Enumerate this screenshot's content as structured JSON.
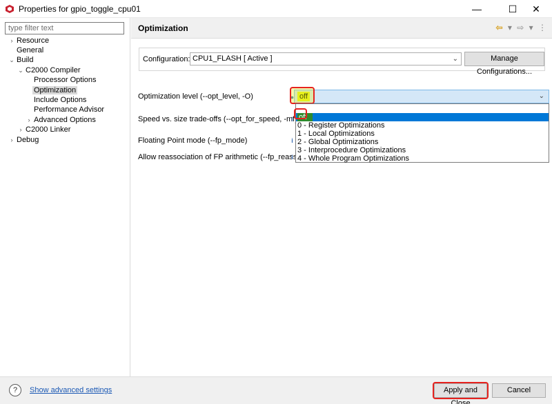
{
  "window": {
    "title": "Properties for gpio_toggle_cpu01",
    "min_icon": "minimize-icon",
    "max_icon": "maximize-icon",
    "close_icon": "close-icon"
  },
  "sidebar": {
    "filter_placeholder": "type filter text",
    "items": [
      {
        "label": "Resource",
        "twisty": "›",
        "level": 0
      },
      {
        "label": "General",
        "twisty": "",
        "level": 0
      },
      {
        "label": "Build",
        "twisty": "⌄",
        "level": 0
      },
      {
        "label": "C2000 Compiler",
        "twisty": "⌄",
        "level": 1
      },
      {
        "label": "Processor Options",
        "twisty": "",
        "level": 2
      },
      {
        "label": "Optimization",
        "twisty": "",
        "level": 2,
        "selected": true
      },
      {
        "label": "Include Options",
        "twisty": "",
        "level": 2
      },
      {
        "label": "Performance Advisor",
        "twisty": "",
        "level": 2
      },
      {
        "label": "Advanced Options",
        "twisty": "›",
        "level": 2
      },
      {
        "label": "C2000 Linker",
        "twisty": "›",
        "level": 1
      },
      {
        "label": "Debug",
        "twisty": "›",
        "level": 0
      }
    ]
  },
  "main": {
    "title": "Optimization",
    "configuration": {
      "label": "Configuration:",
      "value": "CPU1_FLASH  [ Active ]",
      "manage_button": "Manage Configurations..."
    },
    "options": [
      {
        "label": "Optimization level (--opt_level, -O)"
      },
      {
        "label": "Speed vs. size trade-offs (--opt_for_speed, -mf)"
      },
      {
        "label": "Floating Point mode (--fp_mode)"
      },
      {
        "label": "Allow reassociation of FP arithmetic (--fp_reassoc)"
      }
    ],
    "opt_level_value": "off",
    "dropdown_options": [
      "",
      "off",
      "0 - Register Optimizations",
      "1 - Local Optimizations",
      "2 - Global Optimizations",
      "3 - Interprocedure Optimizations",
      "4 - Whole Program Optimizations"
    ]
  },
  "footer": {
    "help_icon": "help-icon",
    "advanced_link": "Show advanced settings",
    "apply_button": "Apply and Close",
    "cancel_button": "Cancel"
  },
  "colors": {
    "highlight_red": "#e6221e",
    "highlight_yellow": "#e6f01c",
    "selection_blue": "#0078d7",
    "link_blue": "#1a58b4"
  }
}
